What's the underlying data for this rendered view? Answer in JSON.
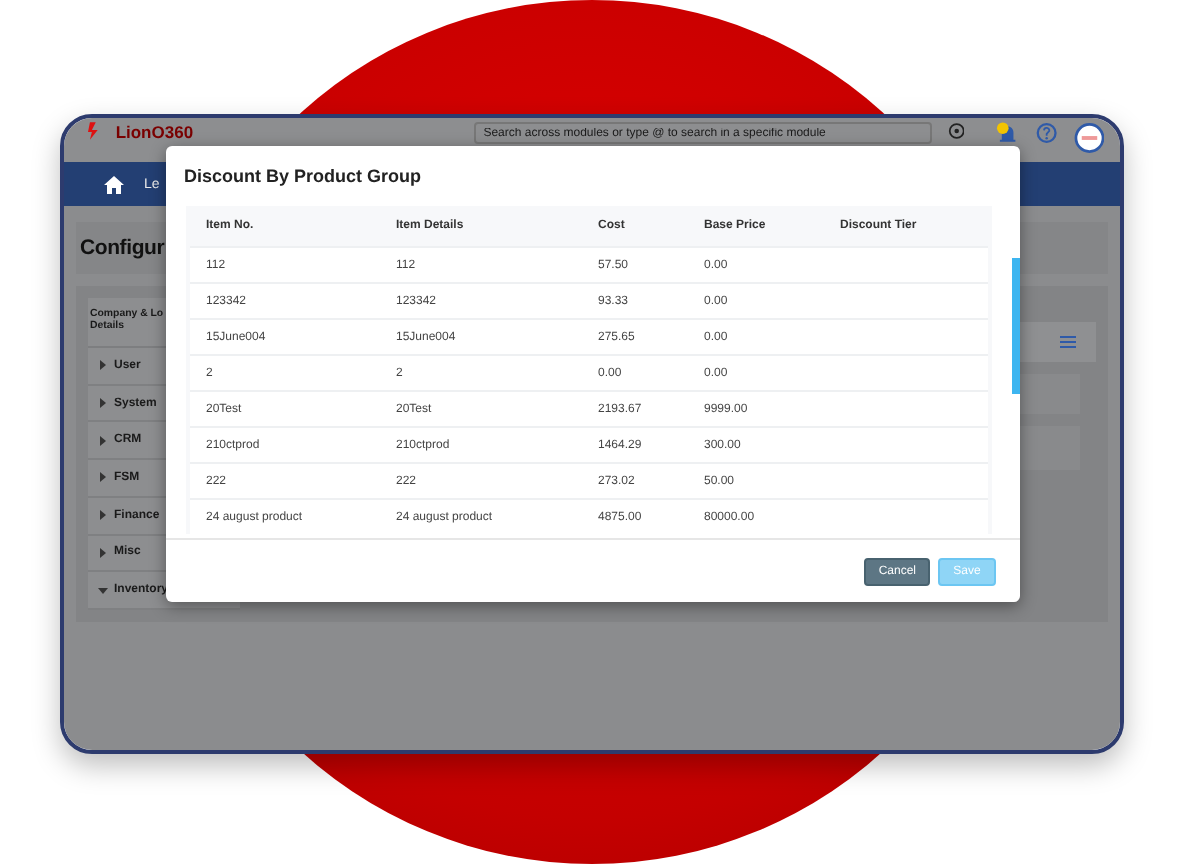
{
  "header": {
    "logo": "LionO360",
    "search": {
      "placeholder": "Search across modules or type @ to search in a specific module"
    }
  },
  "nav": {
    "items": [
      {
        "label": "Le"
      }
    ]
  },
  "page": {
    "title": "Configur"
  },
  "sidebar": {
    "heading_lines": [
      "Company & Lo",
      "Details"
    ],
    "items": [
      {
        "label": "User",
        "expanded": false
      },
      {
        "label": "System",
        "expanded": false
      },
      {
        "label": "CRM",
        "expanded": false
      },
      {
        "label": "FSM",
        "expanded": false
      },
      {
        "label": "Finance",
        "expanded": false
      },
      {
        "label": "Misc",
        "expanded": false
      },
      {
        "label": "Inventory",
        "expanded": true
      }
    ]
  },
  "modal": {
    "title": "Discount By Product Group",
    "columns": [
      "Item No.",
      "Item Details",
      "Cost",
      "Base Price",
      "Discount Tier"
    ],
    "rows": [
      [
        "112",
        "112",
        "57.50",
        "0.00"
      ],
      [
        "123342",
        "123342",
        "93.33",
        "0.00"
      ],
      [
        "15June004",
        "15June004",
        "275.65",
        "0.00"
      ],
      [
        "2",
        "2",
        "0.00",
        "0.00"
      ],
      [
        "20Test",
        "20Test",
        "2193.67",
        "9999.00"
      ],
      [
        "210ctprod",
        "210ctprod",
        "1464.29",
        "300.00"
      ],
      [
        "222",
        "222",
        "273.02",
        "50.00"
      ],
      [
        "24 august product",
        "24 august product",
        "4875.00",
        "80000.00"
      ]
    ],
    "buttons": [
      {
        "label": "Cancel",
        "kind": "secondary",
        "disabled": false
      },
      {
        "label": "Save",
        "kind": "primary",
        "disabled": true
      }
    ]
  }
}
